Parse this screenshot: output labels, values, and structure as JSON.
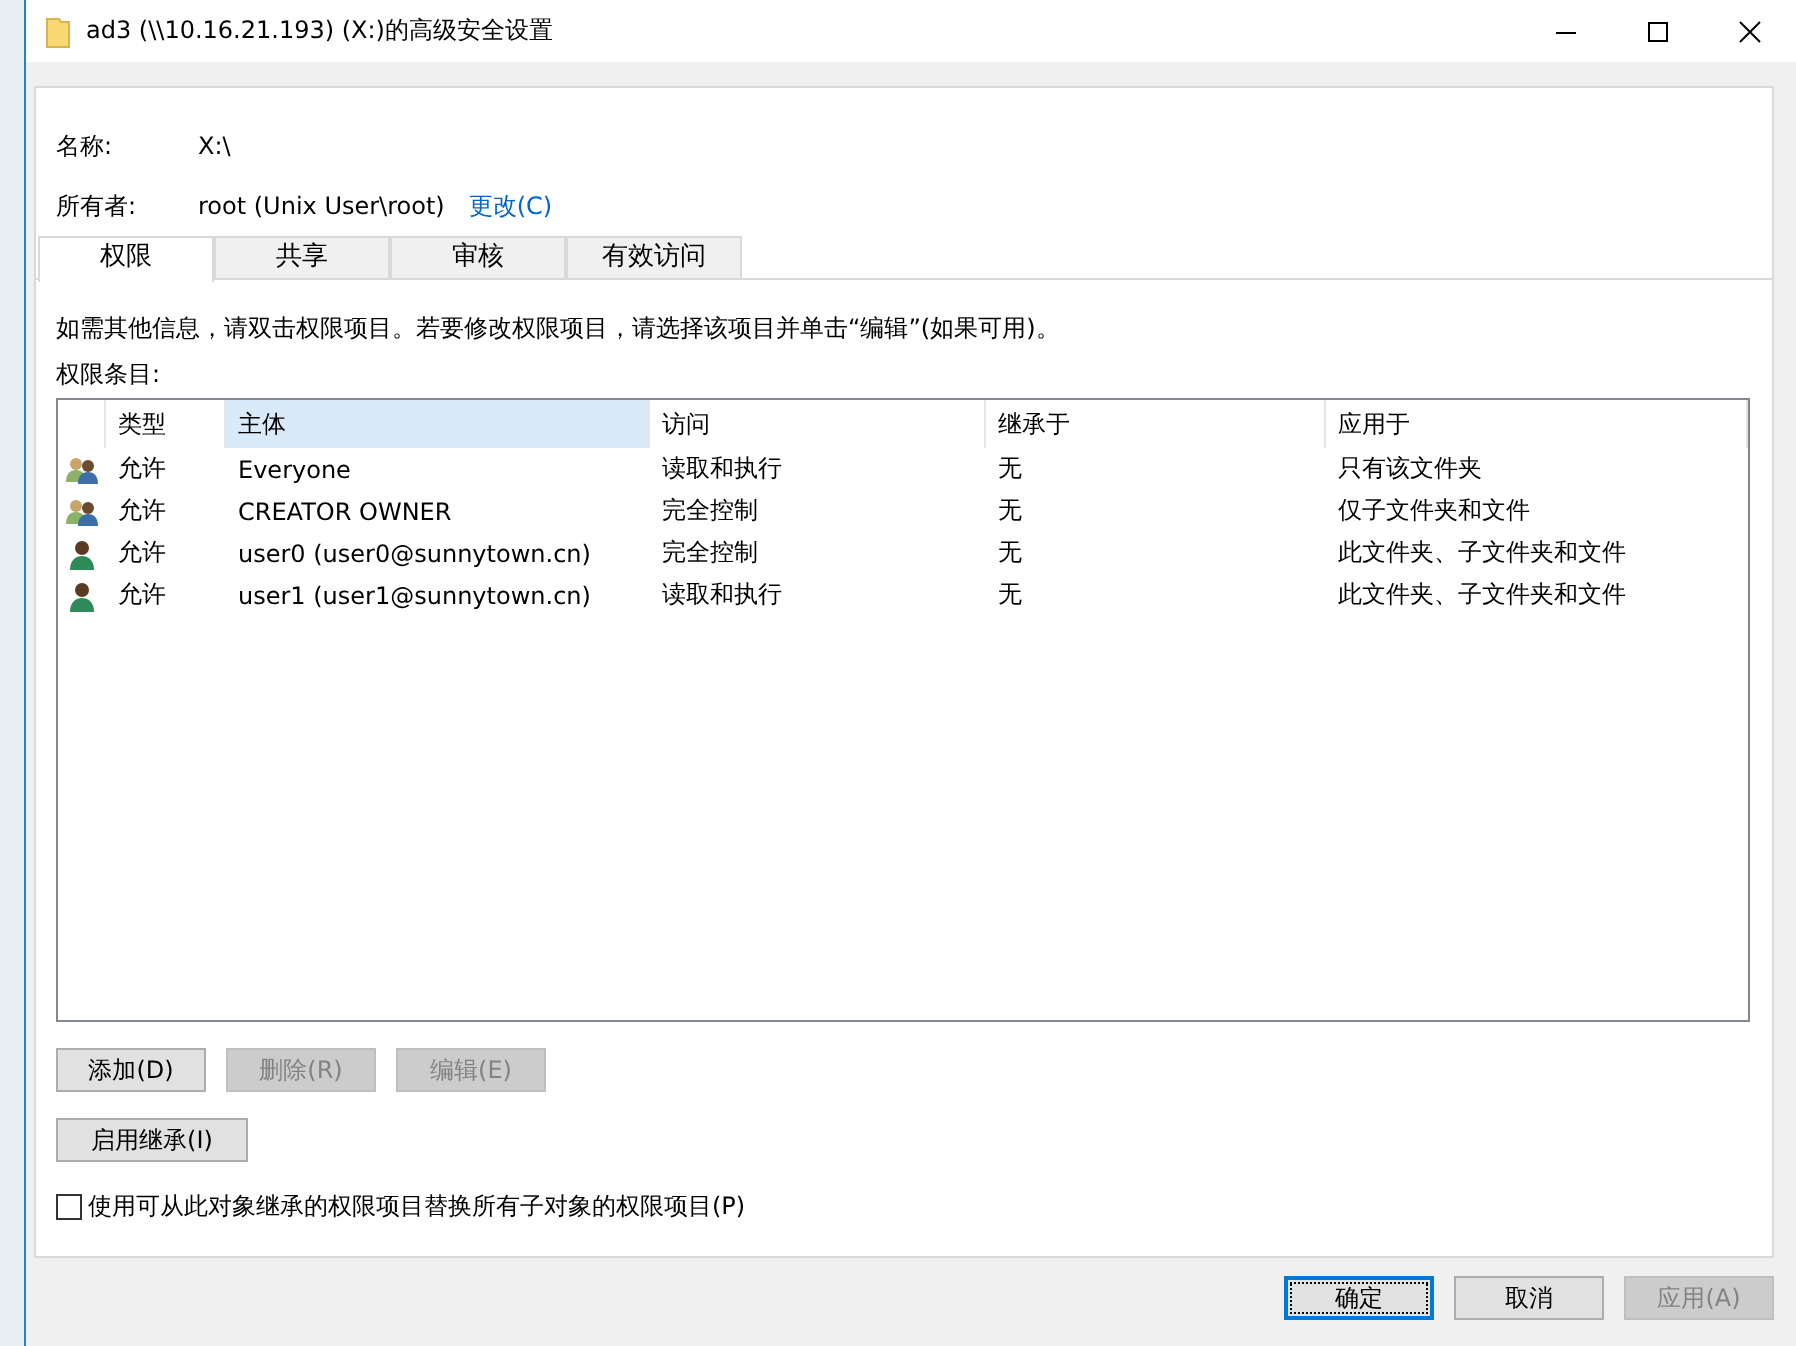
{
  "window": {
    "title": "ad3 (\\\\10.16.21.193) (X:)的高级安全设置"
  },
  "info": {
    "name_label": "名称:",
    "name_value": "X:\\",
    "owner_label": "所有者:",
    "owner_value": "root (Unix User\\root)",
    "owner_link": "更改(C)"
  },
  "tabs": [
    {
      "label": "权限",
      "selected": true
    },
    {
      "label": "共享",
      "selected": false
    },
    {
      "label": "审核",
      "selected": false
    },
    {
      "label": "有效访问",
      "selected": false
    }
  ],
  "description": "如需其他信息，请双击权限项目。若要修改权限项目，请选择该项目并单击“编辑”(如果可用)。",
  "entries_label": "权限条目:",
  "table": {
    "columns": [
      {
        "label": "类型",
        "sorted": false
      },
      {
        "label": "主体",
        "sorted": true
      },
      {
        "label": "访问",
        "sorted": false
      },
      {
        "label": "继承于",
        "sorted": false
      },
      {
        "label": "应用于",
        "sorted": false
      }
    ],
    "rows": [
      {
        "kind": "group",
        "cells": [
          "允许",
          "Everyone",
          "读取和执行",
          "无",
          "只有该文件夹"
        ]
      },
      {
        "kind": "group",
        "cells": [
          "允许",
          "CREATOR OWNER",
          "完全控制",
          "无",
          "仅子文件夹和文件"
        ]
      },
      {
        "kind": "user",
        "cells": [
          "允许",
          "user0 (user0@sunnytown.cn)",
          "完全控制",
          "无",
          "此文件夹、子文件夹和文件"
        ]
      },
      {
        "kind": "user",
        "cells": [
          "允许",
          "user1 (user1@sunnytown.cn)",
          "读取和执行",
          "无",
          "此文件夹、子文件夹和文件"
        ]
      }
    ]
  },
  "entry_buttons": [
    {
      "label": "添加(D)",
      "disabled": false
    },
    {
      "label": "删除(R)",
      "disabled": true
    },
    {
      "label": "编辑(E)",
      "disabled": true
    }
  ],
  "inherit_button": {
    "label": "启用继承(I)",
    "disabled": false
  },
  "replace_checkbox": {
    "label": "使用可从此对象继承的权限项目替换所有子对象的权限项目(P)",
    "checked": false
  },
  "footer_buttons": [
    {
      "label": "确定",
      "disabled": false,
      "default": true
    },
    {
      "label": "取消",
      "disabled": false,
      "default": false
    },
    {
      "label": "应用(A)",
      "disabled": true,
      "default": false
    }
  ]
}
